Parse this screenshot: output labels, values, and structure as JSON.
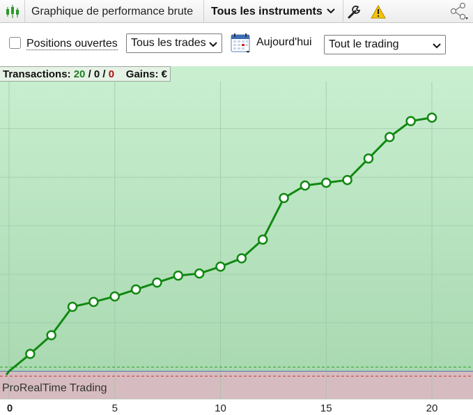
{
  "titlebar": {
    "chart_title": "Graphique de performance brute",
    "instrument_selector": "Tous les instruments",
    "icons": [
      "candlestick-icon",
      "chevron-down-icon",
      "wrench-icon",
      "warning-icon",
      "share-icon"
    ]
  },
  "toolbar": {
    "open_positions_label": "Positions ouvertes",
    "open_positions_checked": false,
    "trades_select": "Tous les trades",
    "date_label": "Aujourd'hui",
    "trading_select": "Tout le trading"
  },
  "summary": {
    "transactions_label": "Transactions:",
    "winning": "20",
    "neutral": "0",
    "losing": "0",
    "separator": "/",
    "gains_label": "Gains:",
    "gains_unit": "€",
    "colors": {
      "winning": "#1e7f1e",
      "losing": "#b01010"
    }
  },
  "watermark": "ProRealTime Trading",
  "chart_data": {
    "type": "line",
    "x_ticks": [
      "0",
      "5",
      "10",
      "15",
      "20"
    ],
    "xlim": [
      0,
      22
    ],
    "x": [
      0,
      1,
      2,
      3,
      4,
      5,
      6,
      7,
      8,
      9,
      10,
      11,
      12,
      13,
      14,
      15,
      16,
      17,
      18,
      19,
      20
    ],
    "series": [
      {
        "color": "#118811",
        "values": [
          0,
          25,
          52,
          93,
          100,
          108,
          118,
          128,
          138,
          141,
          151,
          163,
          190,
          250,
          268,
          272,
          276,
          307,
          338,
          361,
          366
        ]
      }
    ],
    "ylim": [
      -40,
      418
    ],
    "grid": true,
    "baseline": 0,
    "profit_zone_color": "#b7e4bf",
    "loss_zone_color": "#d6bcc0"
  }
}
